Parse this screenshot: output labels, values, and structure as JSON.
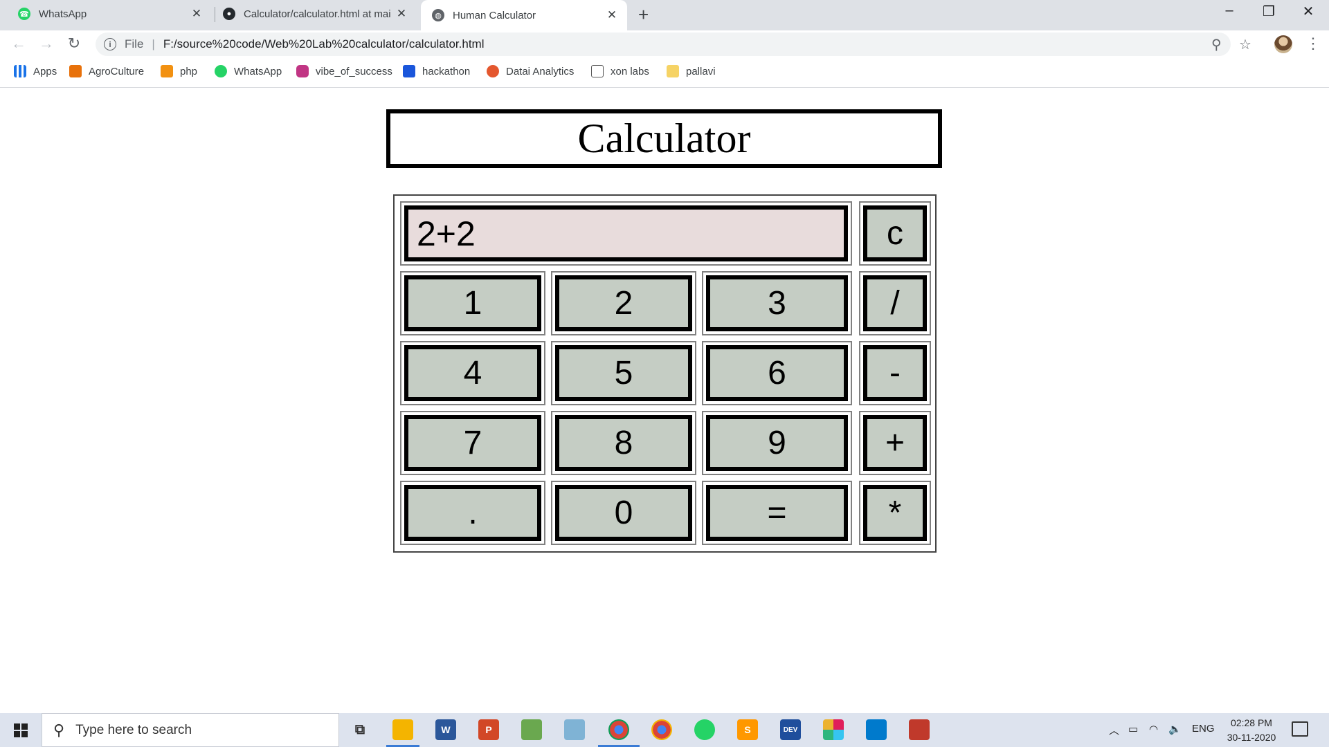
{
  "browser": {
    "tabs": [
      {
        "title": "WhatsApp",
        "icon": "whatsapp-icon",
        "active": false
      },
      {
        "title": "Calculator/calculator.html at mai",
        "icon": "github-icon",
        "active": false
      },
      {
        "title": "Human Calculator",
        "icon": "globe-icon",
        "active": true
      }
    ],
    "address": {
      "scheme_label": "File",
      "url": "F:/source%20code/Web%20Lab%20calculator/calculator.html"
    },
    "bookmarks": [
      {
        "label": "Apps",
        "icon": "apps-grid-icon",
        "color": "#1a73e8"
      },
      {
        "label": "AgroCulture",
        "icon": "agroculture-icon",
        "color": "#e8710a"
      },
      {
        "label": "php",
        "icon": "phpmyadmin-icon",
        "color": "#f29111"
      },
      {
        "label": "WhatsApp",
        "icon": "whatsapp-icon",
        "color": "#25d366"
      },
      {
        "label": "vibe_of_success",
        "icon": "instagram-icon",
        "color": "#c13584"
      },
      {
        "label": "hackathon",
        "icon": "folder-blue-icon",
        "color": "#1a56db"
      },
      {
        "label": "Datai Analytics",
        "icon": "datai-icon",
        "color": "#e4572e"
      },
      {
        "label": "xon labs",
        "icon": "xon-labs-icon",
        "color": "#555555"
      },
      {
        "label": "pallavi",
        "icon": "folder-icon",
        "color": "#f6d365"
      }
    ]
  },
  "page": {
    "title": "Calculator",
    "display_value": "2+2",
    "clear_label": "c",
    "rows": [
      [
        "1",
        "2",
        "3",
        "/"
      ],
      [
        "4",
        "5",
        "6",
        "-"
      ],
      [
        "7",
        "8",
        "9",
        "+"
      ],
      [
        ".",
        "0",
        "=",
        "*"
      ]
    ]
  },
  "taskbar": {
    "search_placeholder": "Type here to search",
    "apps": [
      {
        "name": "task-view-icon",
        "color": "#333333"
      },
      {
        "name": "file-explorer-icon",
        "color": "#f4b400"
      },
      {
        "name": "word-icon",
        "color": "#2b579a"
      },
      {
        "name": "powerpoint-icon",
        "color": "#d24726"
      },
      {
        "name": "paint-icon",
        "color": "#6aa84f"
      },
      {
        "name": "notepad-icon",
        "color": "#7fb3d5"
      },
      {
        "name": "chrome-icon",
        "color": "#db4437"
      },
      {
        "name": "chrome-profile-icon",
        "color": "#db4437"
      },
      {
        "name": "whatsapp-icon",
        "color": "#25d366"
      },
      {
        "name": "sublime-text-icon",
        "color": "#ff9800"
      },
      {
        "name": "dev-cpp-icon",
        "color": "#1f4e9c"
      },
      {
        "name": "slack-icon",
        "color": "#e01e5a"
      },
      {
        "name": "vscode-icon",
        "color": "#007acc"
      },
      {
        "name": "media-app-icon",
        "color": "#c0392b"
      }
    ],
    "tray_language": "ENG",
    "time": "02:28 PM",
    "date": "30-11-2020"
  }
}
